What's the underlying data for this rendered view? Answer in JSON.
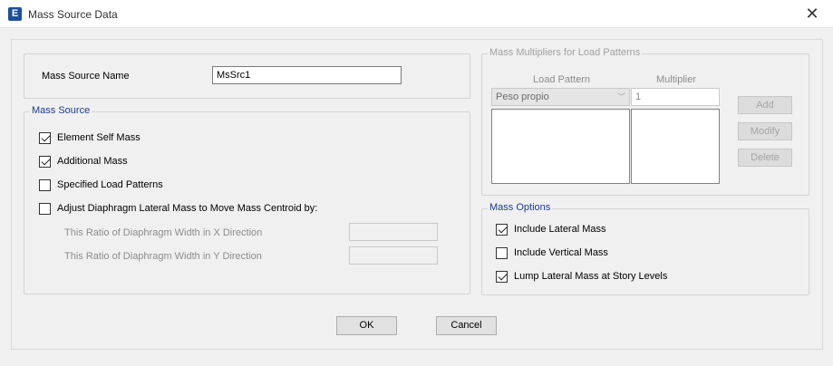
{
  "window": {
    "title": "Mass Source Data",
    "app_icon_letter": "E"
  },
  "mass_source_name": {
    "label": "Mass Source Name",
    "value": "MsSrc1"
  },
  "mass_source": {
    "legend": "Mass Source",
    "element_self_mass": {
      "label": "Element Self Mass",
      "checked": true
    },
    "additional_mass": {
      "label": "Additional Mass",
      "checked": true
    },
    "specified_load_patterns": {
      "label": "Specified Load Patterns",
      "checked": false
    },
    "adjust_diaphragm": {
      "label": "Adjust Diaphragm Lateral Mass to Move Mass Centroid by:",
      "checked": false
    },
    "ratio_x_label": "This Ratio of Diaphragm Width in X Direction",
    "ratio_x_value": "",
    "ratio_y_label": "This Ratio of Diaphragm Width in Y Direction",
    "ratio_y_value": ""
  },
  "multipliers": {
    "legend": "Mass Multipliers for Load Patterns",
    "col_load_pattern": "Load Pattern",
    "col_multiplier": "Multiplier",
    "load_pattern_selected": "Peso propio",
    "multiplier_value": "1",
    "add_label": "Add",
    "modify_label": "Modify",
    "delete_label": "Delete"
  },
  "mass_options": {
    "legend": "Mass Options",
    "include_lateral": {
      "label": "Include Lateral Mass",
      "checked": true
    },
    "include_vertical": {
      "label": "Include Vertical Mass",
      "checked": false
    },
    "lump_lateral": {
      "label": "Lump Lateral Mass at Story Levels",
      "checked": true
    }
  },
  "footer": {
    "ok_label": "OK",
    "cancel_label": "Cancel"
  }
}
